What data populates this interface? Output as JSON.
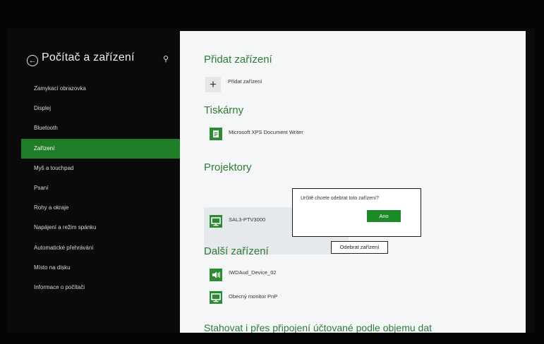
{
  "pane": {
    "title": "Počítač a zařízení",
    "back_icon": "back-arrow-circle-icon",
    "search_icon": "search-icon"
  },
  "nav": {
    "items": [
      {
        "label": "Zamykací obrazovka",
        "active": false
      },
      {
        "label": "Displej",
        "active": false
      },
      {
        "label": "Bluetooth",
        "active": false
      },
      {
        "label": "Zařízení",
        "active": true
      },
      {
        "label": "Myš a touchpad",
        "active": false
      },
      {
        "label": "Psaní",
        "active": false
      },
      {
        "label": "Rohy a okraje",
        "active": false
      },
      {
        "label": "Napájení a režim spánku",
        "active": false
      },
      {
        "label": "Automatické přehrávání",
        "active": false
      },
      {
        "label": "Místo na disku",
        "active": false
      },
      {
        "label": "Informace o počítači",
        "active": false
      }
    ]
  },
  "sections": {
    "add": {
      "title": "Přidat zařízení",
      "button_label": "Přidat zařízení"
    },
    "printers": {
      "title": "Tiskárny",
      "devices": [
        {
          "label": "Microsoft XPS Document Writer",
          "icon": "printer-icon"
        }
      ]
    },
    "projectors": {
      "title": "Projektory",
      "devices": [
        {
          "label": "SAL3-PTV3000",
          "icon": "monitor-icon"
        }
      ]
    },
    "other": {
      "title": "Další zařízení",
      "devices": [
        {
          "label": "IWDAud_Device_02",
          "icon": "speaker-icon"
        },
        {
          "label": "Obecný monitor PnP",
          "icon": "monitor-icon"
        }
      ]
    },
    "metered": {
      "title": "Stahovat i přes připojení účtované podle objemu dat"
    }
  },
  "dialog": {
    "question": "Určitě chcete odebrat toto zařízení?",
    "confirm_label": "Ano"
  },
  "remove_button": {
    "label": "Odebrat zařízení"
  },
  "colors": {
    "accent": "#1e7d26",
    "section_title": "#2e7d32",
    "background_dark": "#0a0a0a",
    "content_bg": "#f4f6f7"
  }
}
